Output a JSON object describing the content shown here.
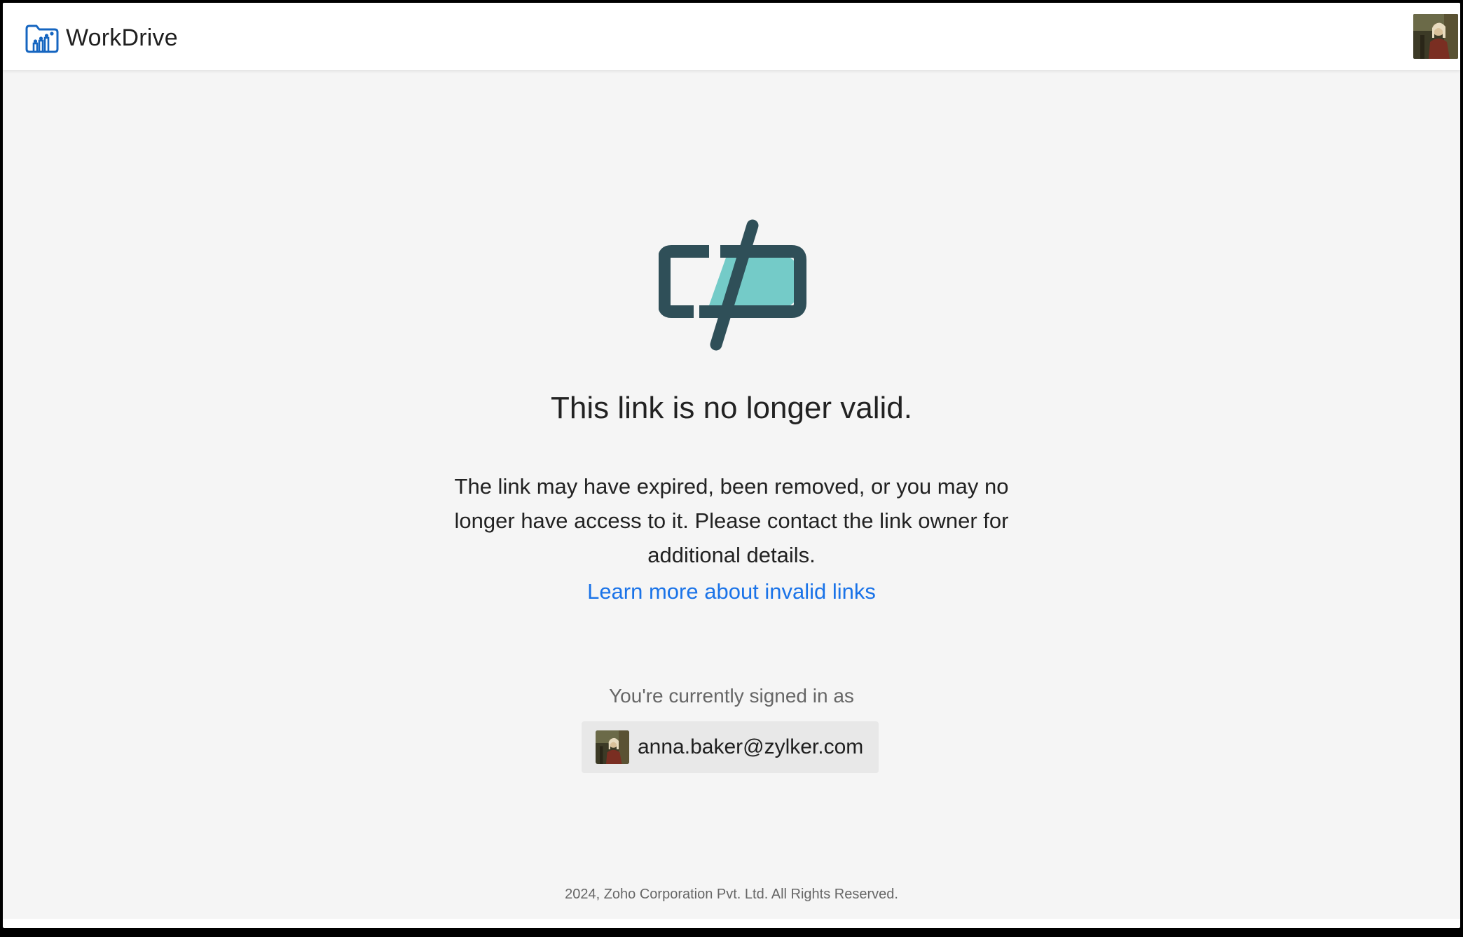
{
  "header": {
    "app_name": "WorkDrive",
    "logo_icon": "workdrive-folder-icon",
    "brand_color": "#1565c0"
  },
  "user": {
    "avatar_icon": "user-avatar-photo",
    "email": "anna.baker@zylker.com"
  },
  "error": {
    "icon": "broken-link-icon",
    "icon_colors": {
      "outline": "#2f4f58",
      "fill": "#74cbc8"
    },
    "title": "This link is no longer valid.",
    "message": "The link may have expired, been removed, or you may no longer have access to it. Please contact the link owner for additional details.",
    "learn_more": "Learn more about invalid links",
    "link_color": "#1a73e8"
  },
  "account": {
    "signed_in_label": "You're currently signed in as"
  },
  "footer": {
    "copyright": "2024, Zoho Corporation Pvt. Ltd. All Rights Reserved."
  }
}
